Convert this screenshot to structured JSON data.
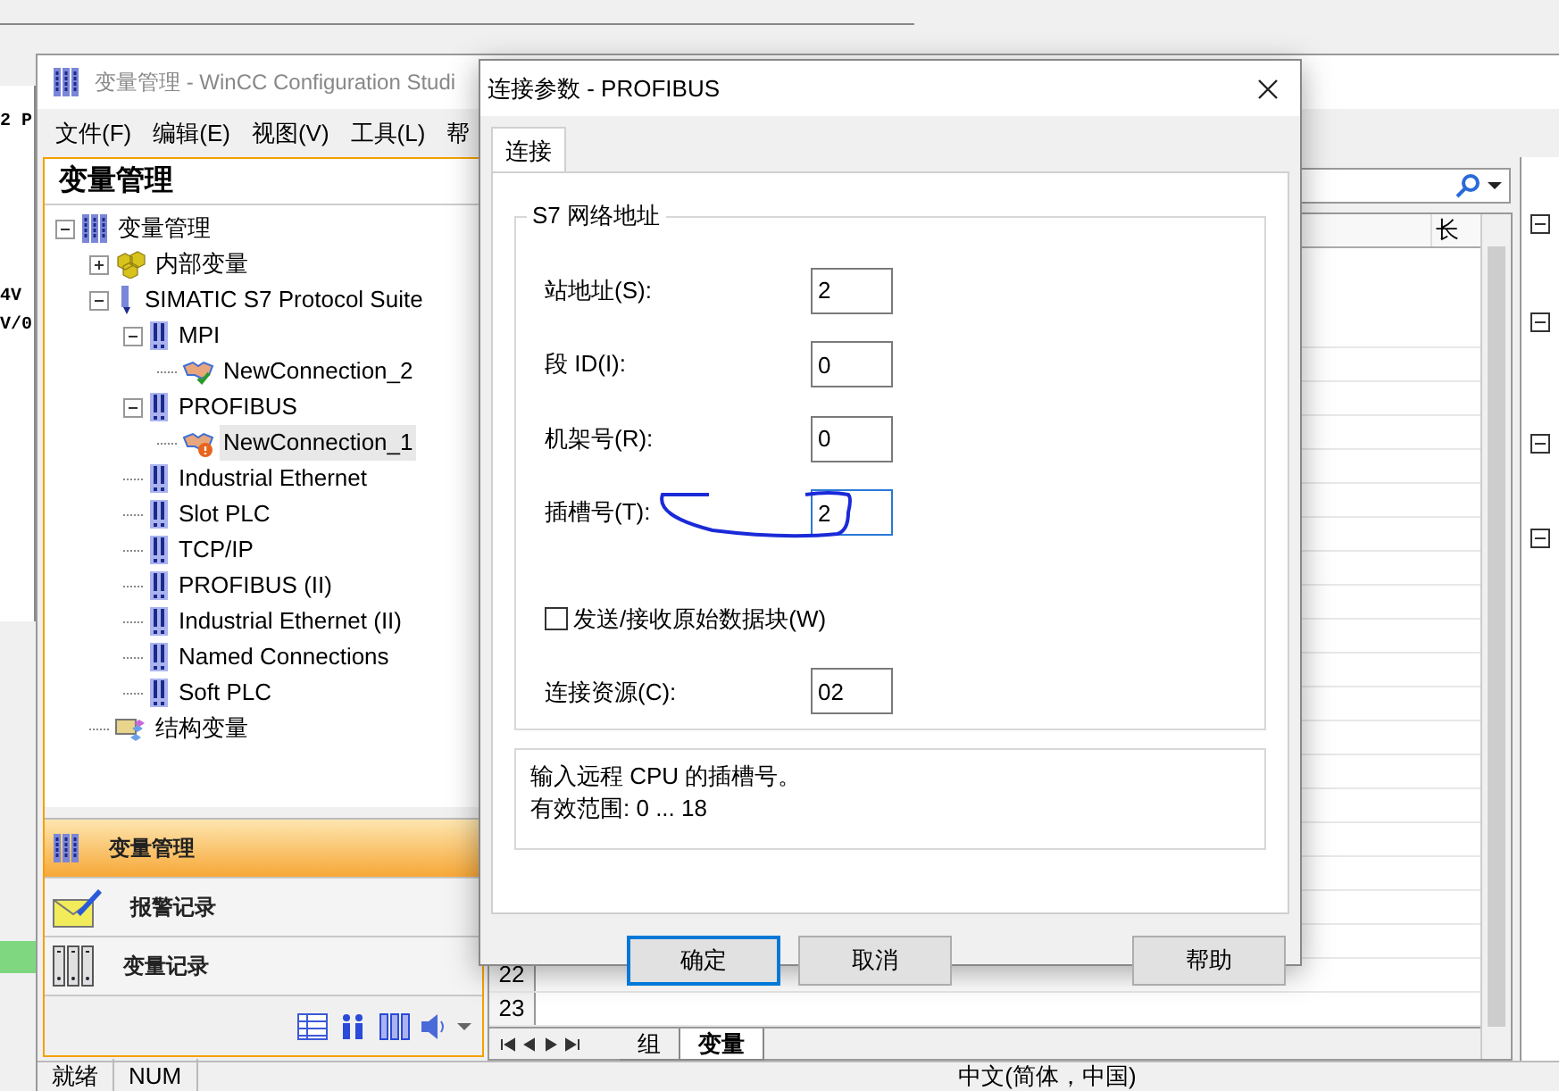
{
  "background_window": {
    "texts": [
      "2 P",
      "4V",
      "V/0"
    ]
  },
  "window": {
    "title": "变量管理 - WinCC Configuration Studi"
  },
  "menu": [
    "文件(F)",
    "编辑(E)",
    "视图(V)",
    "工具(L)",
    "帮"
  ],
  "navigation": {
    "title": "变量管理",
    "tree": [
      {
        "label": "变量管理",
        "kind": "tags",
        "expanded": true,
        "selected": false,
        "children": [
          {
            "label": "内部变量",
            "kind": "cubes",
            "expanded": false,
            "selected": false
          },
          {
            "label": "SIMATIC S7 Protocol Suite",
            "kind": "driver",
            "expanded": true,
            "selected": false,
            "children": [
              {
                "label": "MPI",
                "kind": "channel",
                "expanded": true,
                "selected": false,
                "children": [
                  {
                    "label": "NewConnection_2",
                    "kind": "connection_ok",
                    "selected": false
                  }
                ]
              },
              {
                "label": "PROFIBUS",
                "kind": "channel",
                "expanded": true,
                "selected": false,
                "children": [
                  {
                    "label": "NewConnection_1",
                    "kind": "connection_error",
                    "selected": true
                  }
                ]
              },
              {
                "label": "Industrial Ethernet",
                "kind": "channel",
                "selected": false
              },
              {
                "label": "Slot PLC",
                "kind": "channel",
                "selected": false
              },
              {
                "label": "TCP/IP",
                "kind": "channel",
                "selected": false
              },
              {
                "label": "PROFIBUS (II)",
                "kind": "channel",
                "selected": false
              },
              {
                "label": "Industrial Ethernet (II)",
                "kind": "channel",
                "selected": false
              },
              {
                "label": "Named Connections",
                "kind": "channel",
                "selected": false
              },
              {
                "label": "Soft PLC",
                "kind": "channel",
                "selected": false
              }
            ]
          },
          {
            "label": "结构变量",
            "kind": "struct",
            "selected": false
          }
        ]
      }
    ],
    "sections": [
      {
        "label": "变量管理",
        "kind": "tags",
        "selected": true
      },
      {
        "label": "报警记录",
        "kind": "envelope",
        "selected": false
      },
      {
        "label": "变量记录",
        "kind": "archive",
        "selected": false
      }
    ]
  },
  "table": {
    "columns": [
      "长"
    ],
    "rows": [
      "22",
      "23"
    ],
    "sheet_tabs": [
      {
        "label": "组",
        "selected": false
      },
      {
        "label": "变量",
        "selected": true
      }
    ]
  },
  "dialog": {
    "title": "连接参数 - PROFIBUS",
    "tabs": [
      {
        "label": "连接",
        "selected": true
      }
    ],
    "group": "S7 网络地址",
    "items": [
      {
        "kind": "field",
        "label": "站地址(S):",
        "value": "2",
        "focused": false
      },
      {
        "kind": "field",
        "label": "段 ID(I):",
        "value": "0",
        "focused": false
      },
      {
        "kind": "field",
        "label": "机架号(R):",
        "value": "0",
        "focused": false
      },
      {
        "kind": "field",
        "label": "插槽号(T):",
        "value": "2",
        "focused": true
      },
      {
        "kind": "checkbox",
        "label": "发送/接收原始数据块(W)",
        "checked": false
      },
      {
        "kind": "field",
        "label": "连接资源(C):",
        "value": "02",
        "focused": false
      }
    ],
    "info": [
      "输入远程 CPU 的插槽号。",
      "有效范围: 0 ... 18"
    ],
    "buttons": [
      {
        "label": "确定",
        "default": true
      },
      {
        "label": "取消",
        "default": false
      },
      {
        "label": "帮助",
        "default": false
      }
    ]
  },
  "status_bar": [
    "就绪",
    "NUM",
    "中文(简体，中国)"
  ]
}
